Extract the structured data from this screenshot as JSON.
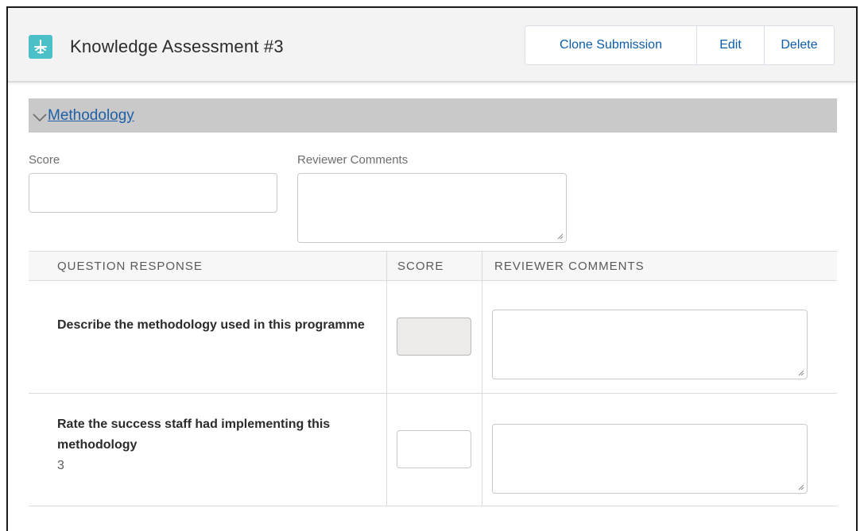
{
  "header": {
    "title": "Knowledge Assessment #3",
    "icon": "airplane-icon",
    "icon_color": "#4bc0c8",
    "actions": {
      "clone_label": "Clone Submission",
      "edit_label": "Edit",
      "delete_label": "Delete"
    }
  },
  "section": {
    "title": "Methodology",
    "expanded": true
  },
  "form": {
    "score_label": "Score",
    "score_value": "",
    "comments_label": "Reviewer Comments",
    "comments_value": ""
  },
  "table": {
    "columns": [
      "QUESTION RESPONSE",
      "SCORE",
      "REVIEWER COMMENTS"
    ],
    "rows": [
      {
        "question": "Describe the methodology used in this programme",
        "response": "",
        "score": "",
        "score_disabled": true,
        "comments": ""
      },
      {
        "question": "Rate the success staff had implementing this methodology",
        "response": "3",
        "score": "",
        "score_disabled": false,
        "comments": ""
      }
    ]
  },
  "colors": {
    "link": "#1f5fa8",
    "button_text": "#0b5cab",
    "section_bar": "#c9c9c9"
  }
}
